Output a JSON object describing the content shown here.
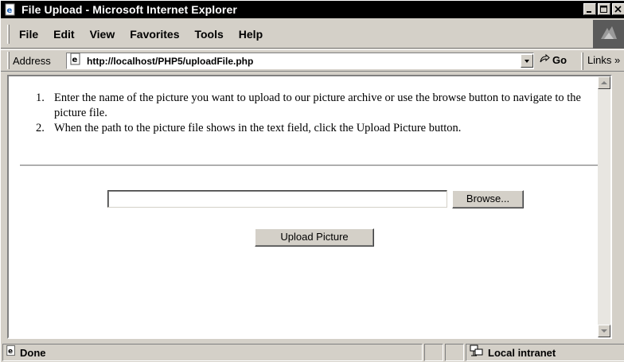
{
  "window": {
    "title": "File Upload - Microsoft Internet Explorer"
  },
  "menu": {
    "items": [
      "File",
      "Edit",
      "View",
      "Favorites",
      "Tools",
      "Help"
    ]
  },
  "address_bar": {
    "label": "Address",
    "url": "http://localhost/PHP5/uploadFile.php",
    "go_label": "Go",
    "links_label": "Links »"
  },
  "page": {
    "instructions": [
      {
        "number": "1.",
        "text": "Enter the name of the picture you want to upload to our picture archive or use the browse button to navigate to the picture file."
      },
      {
        "number": "2.",
        "text": "When the path to the picture file shows in the text field, click the Upload Picture button."
      }
    ],
    "file_field_value": "",
    "browse_label": "Browse...",
    "upload_label": "Upload Picture"
  },
  "status_bar": {
    "status": "Done",
    "zone": "Local intranet"
  },
  "icons": {
    "app": "ie-page-icon",
    "go": "go-arrow-icon",
    "zone": "local-intranet-icon"
  }
}
